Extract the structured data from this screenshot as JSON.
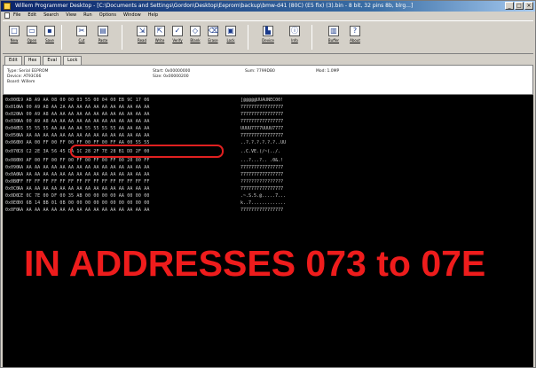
{
  "window": {
    "title": "Willem Programmer Desktop - [C:\\Documents and Settings\\Gordon\\Desktop\\Eeprom\\backup\\bmw-d41 (80C) (E5 fix) (3).bin - 8 bit, 32 pins 8b, blrg...]",
    "controls": [
      "_",
      "□",
      "×"
    ]
  },
  "menu": [
    "File",
    "Edit",
    "Search",
    "View",
    "Run",
    "Options",
    "Window",
    "Help"
  ],
  "toolbar": [
    {
      "label": "New",
      "icon": "new-file-icon"
    },
    {
      "label": "Open",
      "icon": "open-folder-icon"
    },
    {
      "label": "Save",
      "icon": "save-disk-icon"
    },
    {
      "label": "Cut",
      "icon": "cut-icon"
    },
    {
      "label": "Paste",
      "icon": "paste-icon"
    },
    {
      "label": "Read",
      "icon": "read-chip-icon"
    },
    {
      "label": "Write",
      "icon": "write-chip-icon"
    },
    {
      "label": "Verify",
      "icon": "verify-icon"
    },
    {
      "label": "Blank",
      "icon": "blank-check-icon"
    },
    {
      "label": "Erase",
      "icon": "erase-icon"
    },
    {
      "label": "Lock",
      "icon": "lock-icon"
    },
    {
      "label": "Device",
      "icon": "device-icon"
    },
    {
      "label": "Info",
      "icon": "info-icon"
    },
    {
      "label": "Buffer",
      "icon": "buffer-icon"
    },
    {
      "label": "About",
      "icon": "about-icon"
    }
  ],
  "tabs": [
    "Edit",
    "Hex",
    "Eval",
    "Lock"
  ],
  "info": {
    "type_line": "Type: Serial EEPROM",
    "device_line": "Device: AT93C66",
    "board_line": "Board: Willem",
    "start_line": "Start: 0x00000000",
    "size_line": "Size: 0x00000200",
    "checksum_line": "Sum: 7799DB0",
    "mode_line": "Mod: 1.0MP"
  },
  "dump_rows": [
    {
      "addr": "0x000",
      "hex": "19 AB A9 AA 08 00 00 03 55 00 04 00 EB 9C 17 06",
      "ascii": "[@@@@@UUAUNEC00!"
    },
    {
      "addr": "0x010",
      "hex": "AA 00 A9 A8 AA 2A AA AA AA AA AA AA AA AA AA AA",
      "ascii": "7777777777777777"
    },
    {
      "addr": "0x020",
      "hex": "AA 00 A9 A8 AA AA AA AA AA AA AA AA AA AA AA AA",
      "ascii": "7777777777777777"
    },
    {
      "addr": "0x030",
      "hex": "AA 00 A9 A8 AA AA AA AA AA AA AA AA AA AA AA AA",
      "ascii": "7777777777777777"
    },
    {
      "addr": "0x040",
      "hex": "55 55 55 55 AA AA AA AA 55 55 55 55 AA AA AA AA",
      "ascii": "UUUU7777UUUU7777"
    },
    {
      "addr": "0x050",
      "hex": "AA AA AA AA AA AA AA AA AA AA AA AA AA AA AA AA",
      "ascii": "7777777777777777"
    },
    {
      "addr": "0x060",
      "hex": "00 AA 00 FF 00 FF 00 FF 00 FF 00 FF AA 00 55 55",
      "ascii": "..?.?.?.?.?.?..UU"
    },
    {
      "addr": "0x070",
      "hex": "C8 C2 2E 3A 56 45 DA 1C 28 2F 7E 28 B1 DD 2F 00",
      "ascii": "..C.VE.(/~(../."
    },
    {
      "addr": "0x080",
      "hex": "00 AF 00 FF 00 FF 00 FF 00 FF 00 FF 00 20 00 FF",
      "ascii": "...?...?.. .0&.!"
    },
    {
      "addr": "0x090",
      "hex": "AA AA AA AA AA AA AA AA AA AA AA AA AA AA AA AA",
      "ascii": "7777777777777777"
    },
    {
      "addr": "0x0A0",
      "hex": "AA AA AA AA AA AA AA AA AA AA AA AA AA AA AA AA",
      "ascii": "7777777777777777"
    },
    {
      "addr": "0x0B0",
      "hex": "FF FF FF FF FF FF FF FF FF FF FF FF FF FF FF FF",
      "ascii": "????????????????"
    },
    {
      "addr": "0x0C0",
      "hex": "AA AA AA AA AA AA AA AA AA AA AA AA AA AA AA AA",
      "ascii": "7777777777777777"
    },
    {
      "addr": "0x0D0",
      "hex": "CE 0C 7E 00 DF 00 35 AB 00 00 00 00 AA 00 00 00",
      "ascii": ".~.S.5.@.....7..."
    },
    {
      "addr": "0x0E0",
      "hex": "00 6B 14 BB 01 0B 00 00 00 00 00 00 00 00 00 00",
      "ascii": "k..7............."
    },
    {
      "addr": "0x0F0",
      "hex": "AA AA AA AA AA AA AA AA AA AA AA AA AA AA AA AA",
      "ascii": "7777777777777777"
    }
  ],
  "caption": "IN ADDRESSES 073 to 07E",
  "colors": {
    "caption": "#ee1c1c",
    "highlight": "#e02020",
    "dump_bg": "#000000"
  }
}
